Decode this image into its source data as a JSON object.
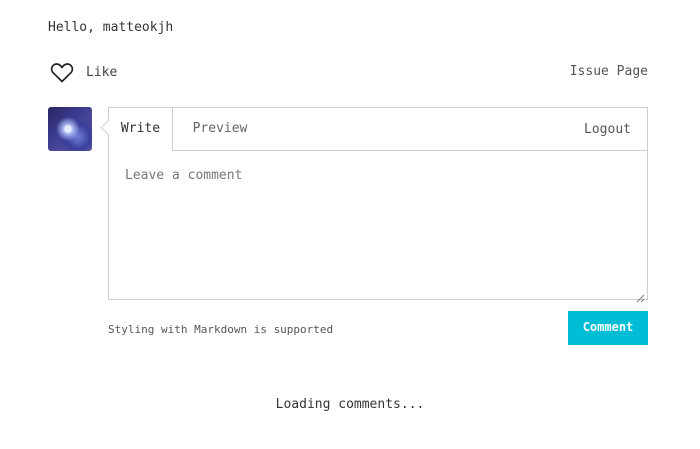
{
  "greeting": "Hello, matteokjh",
  "reactions": {
    "like_label": "Like",
    "like_icon": "heart-outline-icon"
  },
  "issue_link": "Issue Page",
  "editor": {
    "tabs": [
      {
        "label": "Write",
        "active": true
      },
      {
        "label": "Preview",
        "active": false
      }
    ],
    "logout_label": "Logout",
    "textarea_placeholder": "Leave a comment",
    "textarea_value": ""
  },
  "markdown_note": "Styling with Markdown is supported",
  "submit_label": "Comment",
  "loading_text": "Loading comments...",
  "colors": {
    "accent": "#00bcd4",
    "border": "#cfcfcf",
    "text": "#333333"
  }
}
